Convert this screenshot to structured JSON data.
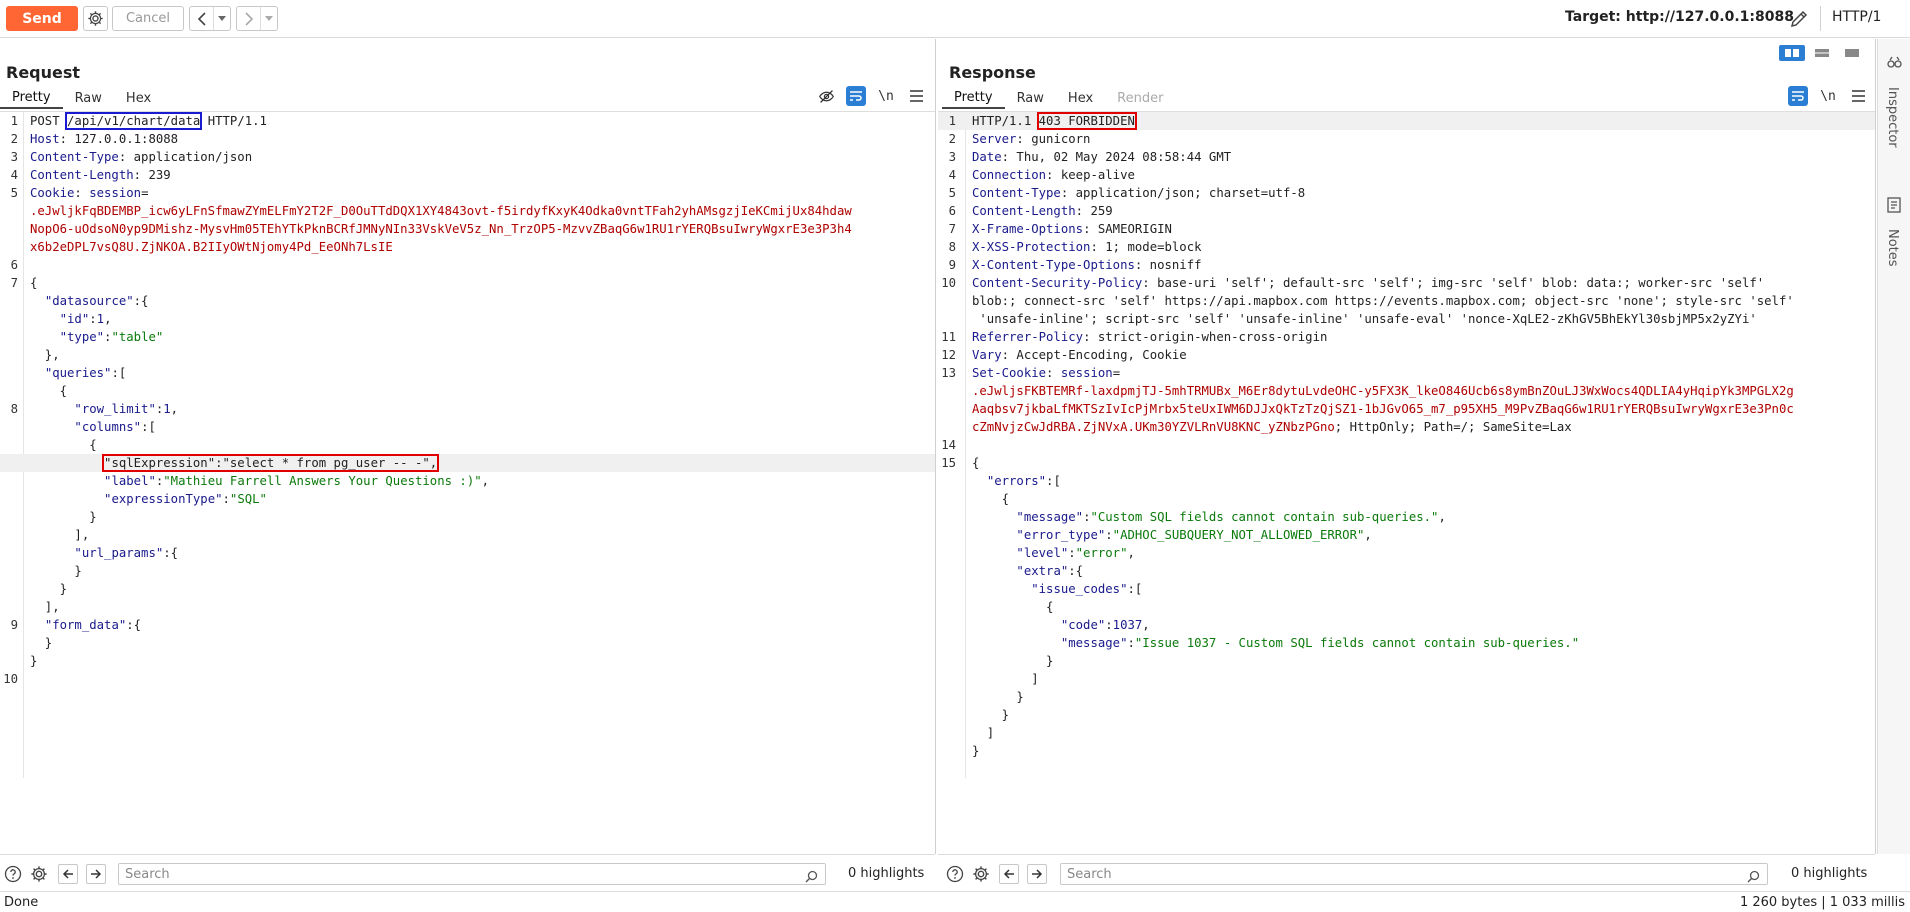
{
  "toolbar": {
    "send_label": "Send",
    "cancel_label": "Cancel",
    "target_label": "Target: http://127.0.0.1:8088",
    "http_version": "HTTP/1"
  },
  "request": {
    "title": "Request",
    "tabs": [
      "Pretty",
      "Raw",
      "Hex"
    ],
    "active_tab": "Pretty",
    "search_placeholder": "Search",
    "highlights": "0 highlights",
    "lines": [
      {
        "n": "1",
        "seg": [
          [
            "POST ",
            ""
          ],
          [
            "/api/v1/chart/data",
            "blue"
          ],
          [
            " HTTP/1.1",
            ""
          ]
        ]
      },
      {
        "n": "2",
        "seg": [
          [
            "Host",
            "h"
          ],
          [
            ": 127.0.0.1:8088",
            ""
          ]
        ]
      },
      {
        "n": "3",
        "seg": [
          [
            "Content-Type",
            "h"
          ],
          [
            ": application/json",
            ""
          ]
        ]
      },
      {
        "n": "4",
        "seg": [
          [
            "Content-Length",
            "h"
          ],
          [
            ": 239",
            ""
          ]
        ]
      },
      {
        "n": "5",
        "seg": [
          [
            "Cookie",
            "h"
          ],
          [
            ": ",
            ""
          ],
          [
            "session",
            "h"
          ],
          [
            "=",
            ""
          ]
        ]
      },
      {
        "n": "",
        "seg": [
          [
            ".eJwljkFqBDEMBP_icw6yLFnSfmawZYmELFmY2T2F_D0OuTTdDQX1XY4843ovt-f5irdyfKxyK4Odka0vntTFah2yhAMsgzjIeKCmijUx84hdaw",
            "r"
          ]
        ]
      },
      {
        "n": "",
        "seg": [
          [
            "NopO6-uOdsoN0yp9DMishz-MysvHm05TEhYTkPknBCRfJMNyNIn33VskVeV5z_Nn_TrzOP5-MzvvZBaqG6w1RU1rYERQBsuIwryWgxrE3e3P3h4",
            "r"
          ]
        ]
      },
      {
        "n": "",
        "seg": [
          [
            "x6b2eDPL7vsQ8U.ZjNKOA.B2IIyOWtNjomy4Pd_EeONh7LsIE",
            "r"
          ]
        ]
      },
      {
        "n": "6",
        "seg": []
      },
      {
        "n": "7",
        "seg": [
          [
            "{",
            ""
          ]
        ]
      },
      {
        "n": "",
        "seg": [
          [
            "  ",
            ""
          ],
          [
            "\"datasource\"",
            "k"
          ],
          [
            ":{",
            ""
          ]
        ]
      },
      {
        "n": "",
        "seg": [
          [
            "    ",
            ""
          ],
          [
            "\"id\"",
            "k"
          ],
          [
            ":",
            ""
          ],
          [
            "1",
            "n"
          ],
          [
            ",",
            ""
          ]
        ]
      },
      {
        "n": "",
        "seg": [
          [
            "    ",
            ""
          ],
          [
            "\"type\"",
            "k"
          ],
          [
            ":",
            ""
          ],
          [
            "\"table\"",
            "s"
          ]
        ]
      },
      {
        "n": "",
        "seg": [
          [
            "  },",
            ""
          ]
        ]
      },
      {
        "n": "",
        "seg": [
          [
            "  ",
            ""
          ],
          [
            "\"queries\"",
            "k"
          ],
          [
            ":[",
            ""
          ]
        ]
      },
      {
        "n": "",
        "seg": [
          [
            "    {",
            ""
          ]
        ]
      },
      {
        "n": "8",
        "seg": [
          [
            "      ",
            ""
          ],
          [
            "\"row_limit\"",
            "k"
          ],
          [
            ":",
            ""
          ],
          [
            "1",
            "n"
          ],
          [
            ",",
            ""
          ]
        ]
      },
      {
        "n": "",
        "seg": [
          [
            "      ",
            ""
          ],
          [
            "\"columns\"",
            "k"
          ],
          [
            ":[",
            ""
          ]
        ]
      },
      {
        "n": "",
        "seg": [
          [
            "        {",
            ""
          ]
        ]
      },
      {
        "n": "",
        "hl": true,
        "seg": [
          [
            "          ",
            ""
          ],
          [
            "\"sqlExpression\":\"select * from pg_user -- -\",",
            "redbox"
          ]
        ]
      },
      {
        "n": "",
        "seg": [
          [
            "          ",
            ""
          ],
          [
            "\"label\"",
            "k"
          ],
          [
            ":",
            ""
          ],
          [
            "\"Mathieu Farrell Answers Your Questions :)\"",
            "s"
          ],
          [
            ",",
            ""
          ]
        ]
      },
      {
        "n": "",
        "seg": [
          [
            "          ",
            ""
          ],
          [
            "\"expressionType\"",
            "k"
          ],
          [
            ":",
            ""
          ],
          [
            "\"SQL\"",
            "s"
          ]
        ]
      },
      {
        "n": "",
        "seg": [
          [
            "        }",
            ""
          ]
        ]
      },
      {
        "n": "",
        "seg": [
          [
            "      ],",
            ""
          ]
        ]
      },
      {
        "n": "",
        "seg": [
          [
            "      ",
            ""
          ],
          [
            "\"url_params\"",
            "k"
          ],
          [
            ":{",
            ""
          ]
        ]
      },
      {
        "n": "",
        "seg": [
          [
            "      }",
            ""
          ]
        ]
      },
      {
        "n": "",
        "seg": [
          [
            "    }",
            ""
          ]
        ]
      },
      {
        "n": "",
        "seg": [
          [
            "  ],",
            ""
          ]
        ]
      },
      {
        "n": "9",
        "seg": [
          [
            "  ",
            ""
          ],
          [
            "\"form_data\"",
            "k"
          ],
          [
            ":{",
            ""
          ]
        ]
      },
      {
        "n": "",
        "seg": [
          [
            "  }",
            ""
          ]
        ]
      },
      {
        "n": "",
        "seg": [
          [
            "}",
            ""
          ]
        ]
      },
      {
        "n": "10",
        "seg": []
      }
    ]
  },
  "response": {
    "title": "Response",
    "tabs": [
      "Pretty",
      "Raw",
      "Hex",
      "Render"
    ],
    "active_tab": "Pretty",
    "search_placeholder": "Search",
    "highlights": "0 highlights",
    "lines": [
      {
        "n": "1",
        "hl": true,
        "seg": [
          [
            "HTTP/1.1 ",
            ""
          ],
          [
            "403 FORBIDDEN",
            "redbox"
          ]
        ]
      },
      {
        "n": "2",
        "seg": [
          [
            "Server",
            "h"
          ],
          [
            ": gunicorn",
            ""
          ]
        ]
      },
      {
        "n": "3",
        "seg": [
          [
            "Date",
            "h"
          ],
          [
            ": Thu, 02 May 2024 08:58:44 GMT",
            ""
          ]
        ]
      },
      {
        "n": "4",
        "seg": [
          [
            "Connection",
            "h"
          ],
          [
            ": keep-alive",
            ""
          ]
        ]
      },
      {
        "n": "5",
        "seg": [
          [
            "Content-Type",
            "h"
          ],
          [
            ": application/json; charset=utf-8",
            ""
          ]
        ]
      },
      {
        "n": "6",
        "seg": [
          [
            "Content-Length",
            "h"
          ],
          [
            ": 259",
            ""
          ]
        ]
      },
      {
        "n": "7",
        "seg": [
          [
            "X-Frame-Options",
            "h"
          ],
          [
            ": SAMEORIGIN",
            ""
          ]
        ]
      },
      {
        "n": "8",
        "seg": [
          [
            "X-XSS-Protection",
            "h"
          ],
          [
            ": 1; mode=block",
            ""
          ]
        ]
      },
      {
        "n": "9",
        "seg": [
          [
            "X-Content-Type-Options",
            "h"
          ],
          [
            ": nosniff",
            ""
          ]
        ]
      },
      {
        "n": "10",
        "seg": [
          [
            "Content-Security-Policy",
            "h"
          ],
          [
            ": base-uri 'self'; default-src 'self'; img-src 'self' blob: data:; worker-src 'self'",
            ""
          ]
        ]
      },
      {
        "n": "",
        "seg": [
          [
            "blob:; connect-src 'self' https://api.mapbox.com https://events.mapbox.com; object-src 'none'; style-src 'self'",
            ""
          ]
        ]
      },
      {
        "n": "",
        "seg": [
          [
            " 'unsafe-inline'; script-src 'self' 'unsafe-inline' 'unsafe-eval' 'nonce-XqLE2-zKhGV5BhEkYl30sbjMP5x2yZYi'",
            ""
          ]
        ]
      },
      {
        "n": "11",
        "seg": [
          [
            "Referrer-Policy",
            "h"
          ],
          [
            ": strict-origin-when-cross-origin",
            ""
          ]
        ]
      },
      {
        "n": "12",
        "seg": [
          [
            "Vary",
            "h"
          ],
          [
            ": Accept-Encoding, Cookie",
            ""
          ]
        ]
      },
      {
        "n": "13",
        "seg": [
          [
            "Set-Cookie",
            "h"
          ],
          [
            ": ",
            ""
          ],
          [
            "session",
            "h"
          ],
          [
            "=",
            ""
          ]
        ]
      },
      {
        "n": "",
        "seg": [
          [
            ".eJwljsFKBTEMRf-laxdpmjTJ-5mhTRMUBx_M6Er8dytuLvdeOHC-y5FX3K_lkeO846Ucb6s8ymBnZOuLJ3WxWocs4QDLIA4yHqipYk3MPGLX2g",
            "r"
          ]
        ]
      },
      {
        "n": "",
        "seg": [
          [
            "Aaqbsv7jkbaLfMKTSzIvIcPjMrbx5teUxIWM6DJJxQkTzTzQjSZ1-1bJGvO65_m7_p95XH5_M9PvZBaqG6w1RU1rYERQBsuIwryWgxrE3e3Pn0c",
            "r"
          ]
        ]
      },
      {
        "n": "",
        "seg": [
          [
            "cZmNvjzCwJdRBA.ZjNVxA.UKm30YZVLRnVU8KNC_yZNbzPGno",
            "r"
          ],
          [
            "; HttpOnly; Path=/; SameSite=Lax",
            ""
          ]
        ]
      },
      {
        "n": "14",
        "seg": []
      },
      {
        "n": "15",
        "seg": [
          [
            "{",
            ""
          ]
        ]
      },
      {
        "n": "",
        "seg": [
          [
            "  ",
            ""
          ],
          [
            "\"errors\"",
            "k"
          ],
          [
            ":[",
            ""
          ]
        ]
      },
      {
        "n": "",
        "seg": [
          [
            "    {",
            ""
          ]
        ]
      },
      {
        "n": "",
        "seg": [
          [
            "      ",
            ""
          ],
          [
            "\"message\"",
            "k"
          ],
          [
            ":",
            ""
          ],
          [
            "\"Custom SQL fields cannot contain sub-queries.\"",
            "s"
          ],
          [
            ",",
            ""
          ]
        ]
      },
      {
        "n": "",
        "seg": [
          [
            "      ",
            ""
          ],
          [
            "\"error_type\"",
            "k"
          ],
          [
            ":",
            ""
          ],
          [
            "\"ADHOC_SUBQUERY_NOT_ALLOWED_ERROR\"",
            "s"
          ],
          [
            ",",
            ""
          ]
        ]
      },
      {
        "n": "",
        "seg": [
          [
            "      ",
            ""
          ],
          [
            "\"level\"",
            "k"
          ],
          [
            ":",
            ""
          ],
          [
            "\"error\"",
            "s"
          ],
          [
            ",",
            ""
          ]
        ]
      },
      {
        "n": "",
        "seg": [
          [
            "      ",
            ""
          ],
          [
            "\"extra\"",
            "k"
          ],
          [
            ":{",
            ""
          ]
        ]
      },
      {
        "n": "",
        "seg": [
          [
            "        ",
            ""
          ],
          [
            "\"issue_codes\"",
            "k"
          ],
          [
            ":[",
            ""
          ]
        ]
      },
      {
        "n": "",
        "seg": [
          [
            "          {",
            ""
          ]
        ]
      },
      {
        "n": "",
        "seg": [
          [
            "            ",
            ""
          ],
          [
            "\"code\"",
            "k"
          ],
          [
            ":",
            ""
          ],
          [
            "1037",
            "n"
          ],
          [
            ",",
            ""
          ]
        ]
      },
      {
        "n": "",
        "seg": [
          [
            "            ",
            ""
          ],
          [
            "\"message\"",
            "k"
          ],
          [
            ":",
            ""
          ],
          [
            "\"Issue 1037 - Custom SQL fields cannot contain sub-queries.\"",
            "s"
          ]
        ]
      },
      {
        "n": "",
        "seg": [
          [
            "          }",
            ""
          ]
        ]
      },
      {
        "n": "",
        "seg": [
          [
            "        ]",
            ""
          ]
        ]
      },
      {
        "n": "",
        "seg": [
          [
            "      }",
            ""
          ]
        ]
      },
      {
        "n": "",
        "seg": [
          [
            "    }",
            ""
          ]
        ]
      },
      {
        "n": "",
        "seg": [
          [
            "  ]",
            ""
          ]
        ]
      },
      {
        "n": "",
        "seg": [
          [
            "}",
            ""
          ]
        ]
      }
    ]
  },
  "rail": {
    "inspector": "Inspector",
    "notes": "Notes"
  },
  "status": {
    "left": "Done",
    "right": "1 260 bytes | 1 033 millis"
  },
  "colors": {
    "send": "#ff6633",
    "accent": "#2a7fd4",
    "highlight_box": "#e00000",
    "url_box": "#1a1ad0"
  }
}
